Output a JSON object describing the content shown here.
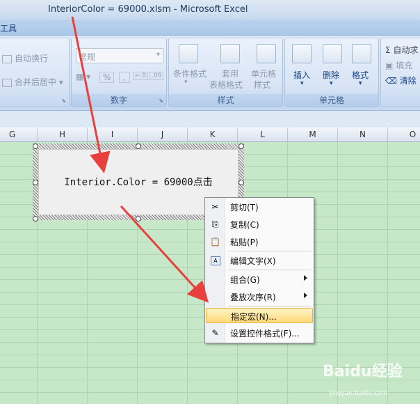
{
  "window": {
    "file": "InteriorColor = 69000.xlsm",
    "sep": " - ",
    "app": "Microsoft Excel"
  },
  "tabrow": {
    "partial_tab": "工具"
  },
  "ribbon": {
    "alignment": {
      "wrap": "自动换行",
      "merge": "合并后居中"
    },
    "number": {
      "format": "常规",
      "percent": "%",
      "comma": ",",
      "label": "数字"
    },
    "styles": {
      "cond": "条件格式",
      "table1": "套用",
      "table2": "表格格式",
      "cell1": "单元格",
      "cell2": "样式",
      "label": "样式"
    },
    "cells": {
      "insert": "插入",
      "delete": "删除",
      "format": "格式",
      "label": "单元格"
    },
    "editing": {
      "autosum": "Σ 自动求",
      "fill": "填充",
      "clear": "清除"
    }
  },
  "columns": [
    "G",
    "H",
    "I",
    "J",
    "K",
    "L",
    "M",
    "N",
    "O"
  ],
  "form_button": {
    "caption": "Interior.Color = 69000点击"
  },
  "context_menu": {
    "items": [
      {
        "label": "剪切(T)",
        "icon": "scissors-icon"
      },
      {
        "label": "复制(C)",
        "icon": "copy-icon"
      },
      {
        "label": "粘贴(P)",
        "icon": "paste-icon"
      },
      {
        "label": "编辑文字(X)",
        "icon": "edit-text-icon"
      },
      {
        "label": "组合(G)",
        "icon": ""
      },
      {
        "label": "叠放次序(R)",
        "icon": ""
      },
      {
        "label": "指定宏(N)...",
        "icon": ""
      },
      {
        "label": "设置控件格式(F)...",
        "icon": "format-control-icon"
      }
    ],
    "highlighted": "指定宏(N)..."
  },
  "watermark": {
    "brand": "Baidu经验",
    "url": "jingyan.baidu.com"
  },
  "colors": {
    "arrow": "#e8403c",
    "grid": "#c6e8c9",
    "highlight": "#ffd978"
  }
}
